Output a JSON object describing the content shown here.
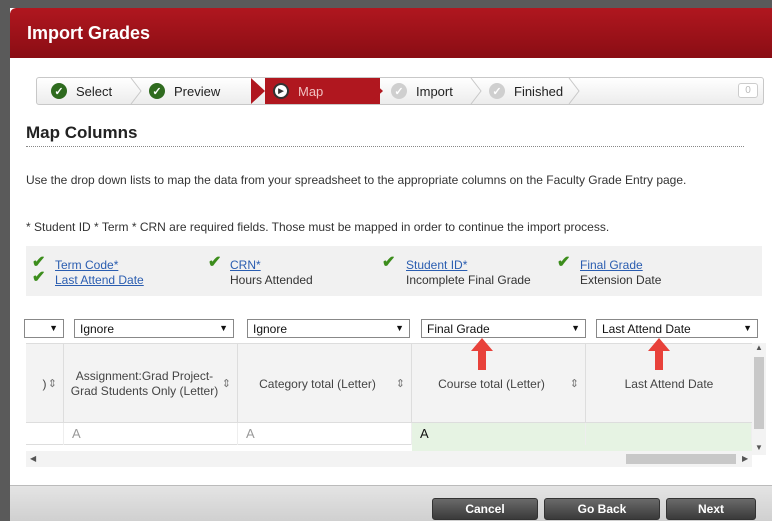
{
  "window": {
    "title": "Import Grades"
  },
  "wizard": {
    "steps": [
      {
        "label": "Select",
        "state": "done"
      },
      {
        "label": "Preview",
        "state": "done"
      },
      {
        "label": "Map",
        "state": "active"
      },
      {
        "label": "Import",
        "state": "pending"
      },
      {
        "label": "Finished",
        "state": "pending"
      }
    ],
    "count": "0"
  },
  "section": {
    "title": "Map Columns",
    "instructions": "Use the drop down lists to map the data from your spreadsheet to the appropriate columns on the Faculty Grade Entry page.",
    "required_note": "* Student ID * Term * CRN are required fields. Those must be mapped in order to continue the import process."
  },
  "mapped_fields": {
    "col1": [
      "Term Code*",
      "Last Attend Date"
    ],
    "col2": [
      "CRN*",
      "Hours Attended"
    ],
    "col3": [
      "Student ID*",
      "Incomplete Final Grade"
    ],
    "col4": [
      "Final Grade",
      "Extension Date"
    ]
  },
  "mapping_selects": [
    {
      "value": ""
    },
    {
      "value": "Ignore"
    },
    {
      "value": "Ignore"
    },
    {
      "value": "Final Grade"
    },
    {
      "value": "Last Attend Date"
    }
  ],
  "columns": [
    {
      "header": ")"
    },
    {
      "header": "Assignment:Grad Project-Grad Students Only (Letter)"
    },
    {
      "header": "Category total (Letter)"
    },
    {
      "header": "Course total (Letter)"
    },
    {
      "header": "Last Attend Date"
    }
  ],
  "rows": [
    [
      "",
      "A",
      "A",
      "A",
      ""
    ]
  ],
  "footer": {
    "cancel": "Cancel",
    "back": "Go Back",
    "next": "Next"
  },
  "colors": {
    "brand": "#b0171f",
    "check": "#3c8d1c",
    "link": "#2a5db0",
    "highlight": "#e6f3e3"
  }
}
